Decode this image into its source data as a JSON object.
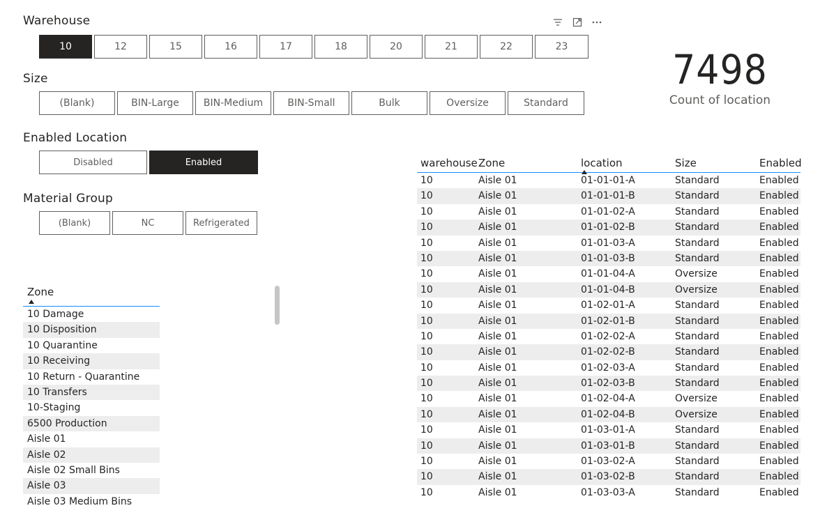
{
  "warehouse": {
    "title": "Warehouse",
    "options": [
      "10",
      "12",
      "15",
      "16",
      "17",
      "18",
      "20",
      "21",
      "22",
      "23"
    ],
    "selected": "10"
  },
  "size": {
    "title": "Size",
    "options": [
      "(Blank)",
      "BIN-Large",
      "BIN-Medium",
      "BIN-Small",
      "Bulk",
      "Oversize",
      "Standard"
    ]
  },
  "enabled_location": {
    "title": "Enabled Location",
    "options": [
      "Disabled",
      "Enabled"
    ],
    "selected": "Enabled"
  },
  "material_group": {
    "title": "Material Group",
    "options": [
      "(Blank)",
      "NC",
      "Refrigerated"
    ]
  },
  "visual_header": {
    "icons": [
      "filter-icon",
      "focus-mode-icon",
      "more-options-icon"
    ]
  },
  "card": {
    "value": "7498",
    "label": "Count of location"
  },
  "zone_table": {
    "header": "Zone",
    "sort": "ascending",
    "rows": [
      "10 Damage",
      "10 Disposition",
      "10 Quarantine",
      "10 Receiving",
      "10 Return - Quarantine",
      "10 Transfers",
      "10-Staging",
      "6500 Production",
      "Aisle 01",
      "Aisle 02",
      "Aisle 02 Small Bins",
      "Aisle 03",
      "Aisle 03 Medium Bins"
    ]
  },
  "location_table": {
    "columns": [
      "warehouse",
      "Zone",
      "location",
      "Size",
      "Enabled"
    ],
    "sorted_column": "location",
    "rows": [
      [
        "10",
        "Aisle 01",
        "01-01-01-A",
        "Standard",
        "Enabled"
      ],
      [
        "10",
        "Aisle 01",
        "01-01-01-B",
        "Standard",
        "Enabled"
      ],
      [
        "10",
        "Aisle 01",
        "01-01-02-A",
        "Standard",
        "Enabled"
      ],
      [
        "10",
        "Aisle 01",
        "01-01-02-B",
        "Standard",
        "Enabled"
      ],
      [
        "10",
        "Aisle 01",
        "01-01-03-A",
        "Standard",
        "Enabled"
      ],
      [
        "10",
        "Aisle 01",
        "01-01-03-B",
        "Standard",
        "Enabled"
      ],
      [
        "10",
        "Aisle 01",
        "01-01-04-A",
        "Oversize",
        "Enabled"
      ],
      [
        "10",
        "Aisle 01",
        "01-01-04-B",
        "Oversize",
        "Enabled"
      ],
      [
        "10",
        "Aisle 01",
        "01-02-01-A",
        "Standard",
        "Enabled"
      ],
      [
        "10",
        "Aisle 01",
        "01-02-01-B",
        "Standard",
        "Enabled"
      ],
      [
        "10",
        "Aisle 01",
        "01-02-02-A",
        "Standard",
        "Enabled"
      ],
      [
        "10",
        "Aisle 01",
        "01-02-02-B",
        "Standard",
        "Enabled"
      ],
      [
        "10",
        "Aisle 01",
        "01-02-03-A",
        "Standard",
        "Enabled"
      ],
      [
        "10",
        "Aisle 01",
        "01-02-03-B",
        "Standard",
        "Enabled"
      ],
      [
        "10",
        "Aisle 01",
        "01-02-04-A",
        "Oversize",
        "Enabled"
      ],
      [
        "10",
        "Aisle 01",
        "01-02-04-B",
        "Oversize",
        "Enabled"
      ],
      [
        "10",
        "Aisle 01",
        "01-03-01-A",
        "Standard",
        "Enabled"
      ],
      [
        "10",
        "Aisle 01",
        "01-03-01-B",
        "Standard",
        "Enabled"
      ],
      [
        "10",
        "Aisle 01",
        "01-03-02-A",
        "Standard",
        "Enabled"
      ],
      [
        "10",
        "Aisle 01",
        "01-03-02-B",
        "Standard",
        "Enabled"
      ],
      [
        "10",
        "Aisle 01",
        "01-03-03-A",
        "Standard",
        "Enabled"
      ]
    ]
  }
}
